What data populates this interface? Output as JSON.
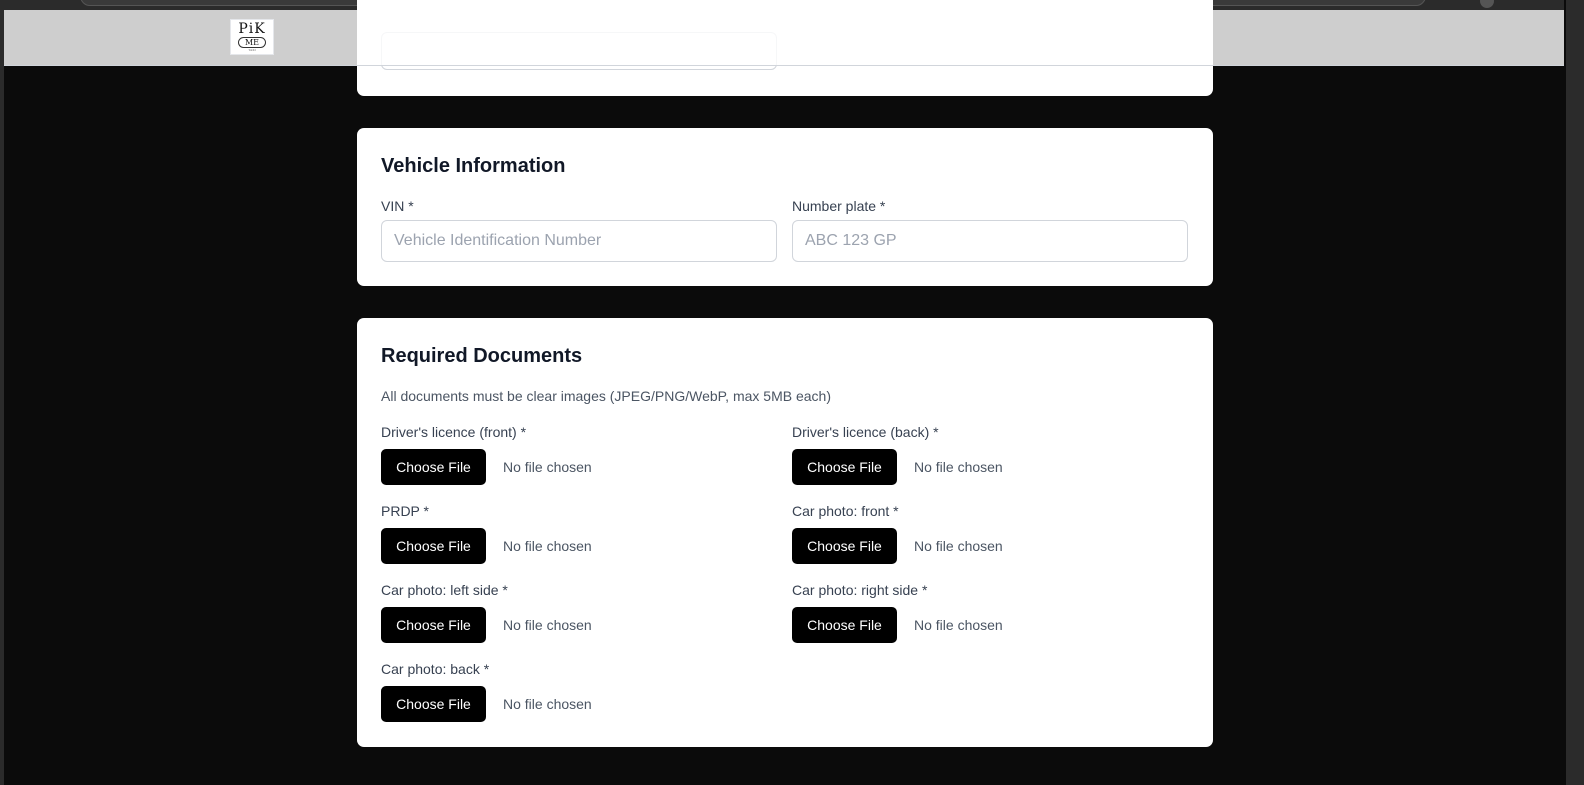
{
  "header": {
    "logo": {
      "line1": "PiK",
      "line2": "ME",
      "line3": "TAXI"
    }
  },
  "vehicle": {
    "title": "Vehicle Information",
    "vin_label": "VIN *",
    "vin_placeholder": "Vehicle Identification Number",
    "plate_label": "Number plate *",
    "plate_placeholder": "ABC 123 GP"
  },
  "documents": {
    "title": "Required Documents",
    "description": "All documents must be clear images (JPEG/PNG/WebP, max 5MB each)",
    "button_label": "Choose File",
    "no_file_text": "No file chosen",
    "items": [
      {
        "label": "Driver's licence (front) *"
      },
      {
        "label": "Driver's licence (back) *"
      },
      {
        "label": "PRDP *"
      },
      {
        "label": "Car photo: front *"
      },
      {
        "label": "Car photo: left side *"
      },
      {
        "label": "Car photo: right side *"
      },
      {
        "label": "Car photo: back *"
      }
    ]
  }
}
